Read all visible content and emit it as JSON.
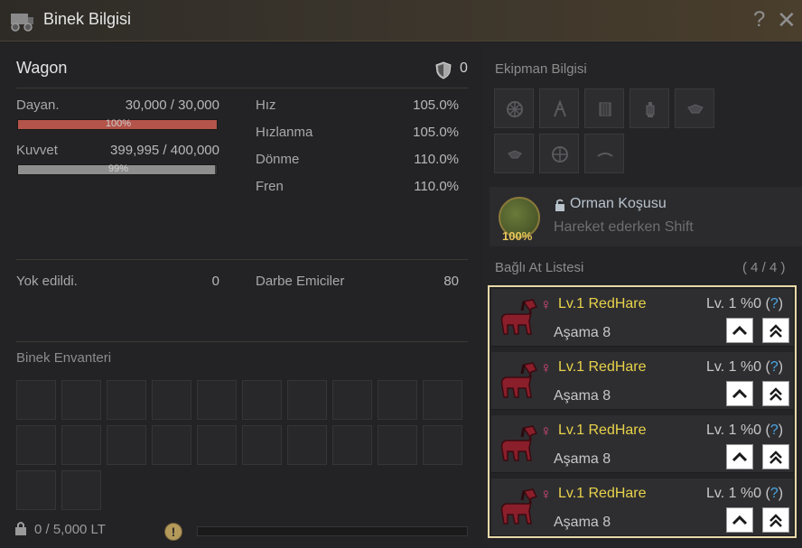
{
  "window": {
    "title": "Binek Bilgisi",
    "help": "?",
    "close": "✕"
  },
  "wagon": {
    "name": "Wagon",
    "shield_value": "0",
    "durability": {
      "label": "Dayan.",
      "value": "30,000 / 30,000",
      "percent": 100,
      "percent_text": "100%",
      "color": "#b4544a"
    },
    "power": {
      "label": "Kuvvet",
      "value": "399,995 / 400,000",
      "percent": 99,
      "percent_text": "99%",
      "color": "#8e8e8e"
    },
    "stats": [
      {
        "label": "Hız",
        "value": "105.0%"
      },
      {
        "label": "Hızlanma",
        "value": "105.0%"
      },
      {
        "label": "Dönme",
        "value": "110.0%"
      },
      {
        "label": "Fren",
        "value": "110.0%"
      }
    ],
    "destroyed": {
      "label": "Yok edildi.",
      "value": "0"
    },
    "absorbers": {
      "label": "Darbe Emiciler",
      "value": "80"
    }
  },
  "inventory": {
    "title": "Binek Envanteri",
    "weight": "0 / 5,000 LT",
    "warning_icon": "!"
  },
  "equipment": {
    "title": "Ekipman Bilgisi"
  },
  "skill": {
    "name": "Orman Koşusu",
    "desc": "Hareket ederken Shift",
    "percent": "100%"
  },
  "horse_list": {
    "title": "Bağlı At Listesi",
    "count": "( 4 / 4 )",
    "sex_symbol": "♀",
    "horses": [
      {
        "name": "Lv.1 RedHare",
        "level": "Lv. 1 %0 (",
        "q": "?",
        "close_paren": ")",
        "stage": "Aşama 8"
      },
      {
        "name": "Lv.1 RedHare",
        "level": "Lv. 1 %0 (",
        "q": "?",
        "close_paren": ")",
        "stage": "Aşama 8"
      },
      {
        "name": "Lv.1 RedHare",
        "level": "Lv. 1 %0 (",
        "q": "?",
        "close_paren": ")",
        "stage": "Aşama 8"
      },
      {
        "name": "Lv.1 RedHare",
        "level": "Lv. 1 %0 (",
        "q": "?",
        "close_paren": ")",
        "stage": "Aşama 8"
      }
    ]
  }
}
